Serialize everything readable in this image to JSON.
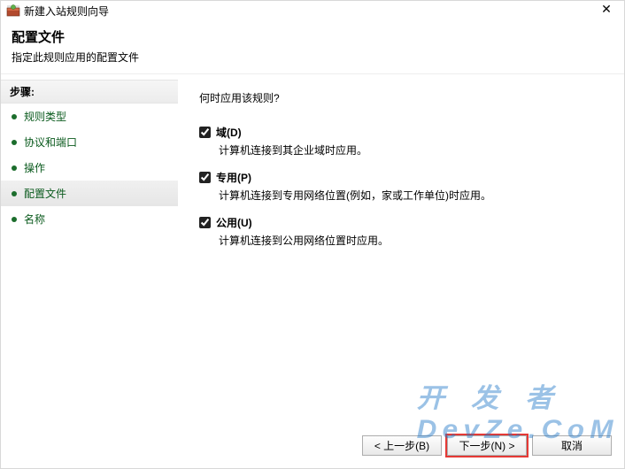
{
  "titlebar": {
    "icon_name": "firewall-icon",
    "title": "新建入站规则向导",
    "close_glyph": "✕"
  },
  "header": {
    "page_title": "配置文件",
    "page_desc": "指定此规则应用的配置文件"
  },
  "sidebar": {
    "steps_label": "步骤:",
    "items": [
      {
        "label": "规则类型"
      },
      {
        "label": "协议和端口"
      },
      {
        "label": "操作"
      },
      {
        "label": "配置文件"
      },
      {
        "label": "名称"
      }
    ],
    "active_index": 3
  },
  "main": {
    "question": "何时应用该规则?",
    "options": [
      {
        "label": "域(D)",
        "desc": "计算机连接到其企业域时应用。",
        "checked": true
      },
      {
        "label": "专用(P)",
        "desc": "计算机连接到专用网络位置(例如，家或工作单位)时应用。",
        "checked": true
      },
      {
        "label": "公用(U)",
        "desc": "计算机连接到公用网络位置时应用。",
        "checked": true
      }
    ]
  },
  "footer": {
    "back_label": "< 上一步(B)",
    "next_label": "下一步(N) >",
    "cancel_label": "取消"
  },
  "watermark": {
    "text_cn": "开 发 者",
    "text_en": "DevZe.CoM"
  }
}
